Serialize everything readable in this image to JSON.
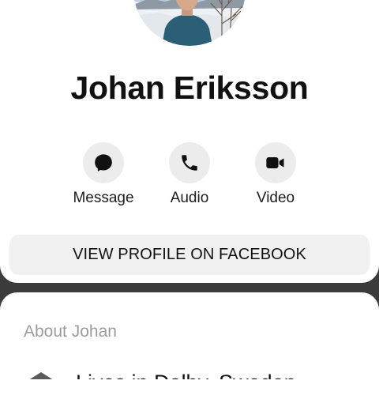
{
  "profile": {
    "name": "Johan Eriksson"
  },
  "actions": [
    {
      "label": "Message",
      "icon": "messenger-icon"
    },
    {
      "label": "Audio",
      "icon": "phone-icon"
    },
    {
      "label": "Video",
      "icon": "video-camera-icon"
    }
  ],
  "view_profile_label": "VIEW PROFILE ON FACEBOOK",
  "about": {
    "heading": "About Johan",
    "lives_in_text": "Lives in Dalby, Sweden",
    "lives_in_icon": "home-icon"
  },
  "colors": {
    "background": "#3b3b3b",
    "card": "#ffffff",
    "button_fill": "#ececec",
    "text": "#111111",
    "muted_text": "#9c9c9c"
  }
}
